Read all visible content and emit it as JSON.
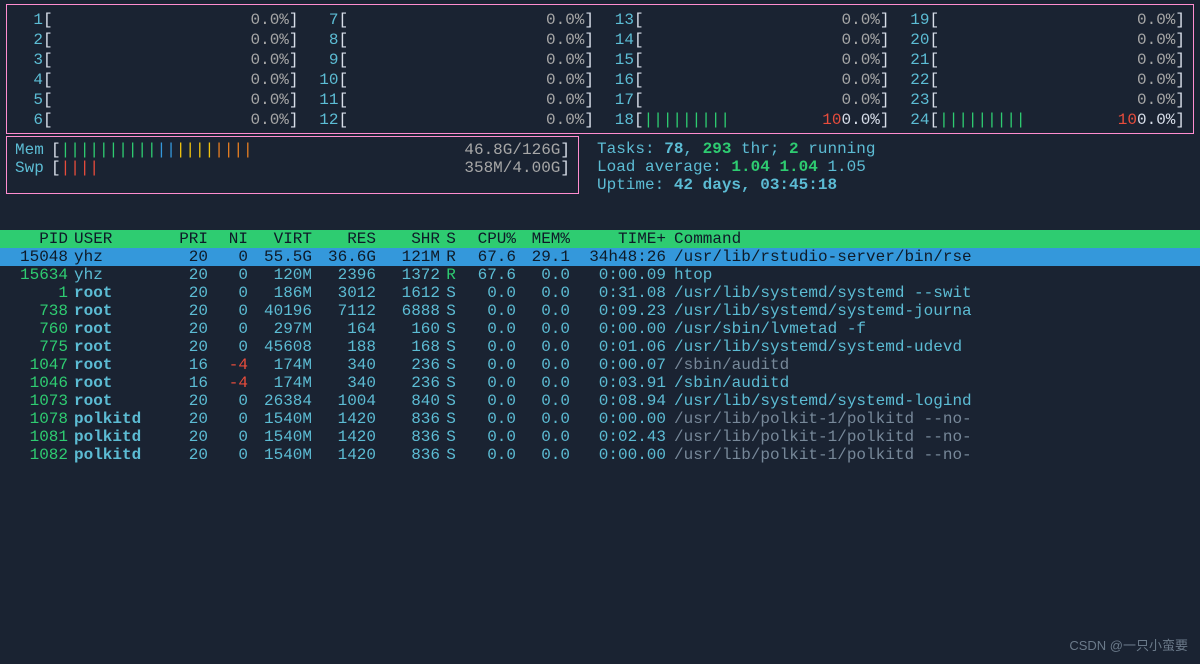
{
  "cpus": [
    {
      "n": "1",
      "fill": "",
      "pct": "0.0%",
      "full": false
    },
    {
      "n": "2",
      "fill": "",
      "pct": "0.0%",
      "full": false
    },
    {
      "n": "3",
      "fill": "",
      "pct": "0.0%",
      "full": false
    },
    {
      "n": "4",
      "fill": "",
      "pct": "0.0%",
      "full": false
    },
    {
      "n": "5",
      "fill": "",
      "pct": "0.0%",
      "full": false
    },
    {
      "n": "6",
      "fill": "",
      "pct": "0.0%",
      "full": false
    },
    {
      "n": "7",
      "fill": "",
      "pct": "0.0%",
      "full": false
    },
    {
      "n": "8",
      "fill": "",
      "pct": "0.0%",
      "full": false
    },
    {
      "n": "9",
      "fill": "",
      "pct": "0.0%",
      "full": false
    },
    {
      "n": "10",
      "fill": "",
      "pct": "0.0%",
      "full": false
    },
    {
      "n": "11",
      "fill": "",
      "pct": "0.0%",
      "full": false
    },
    {
      "n": "12",
      "fill": "",
      "pct": "0.0%",
      "full": false
    },
    {
      "n": "13",
      "fill": "",
      "pct": "0.0%",
      "full": false
    },
    {
      "n": "14",
      "fill": "",
      "pct": "0.0%",
      "full": false
    },
    {
      "n": "15",
      "fill": "",
      "pct": "0.0%",
      "full": false
    },
    {
      "n": "16",
      "fill": "",
      "pct": "0.0%",
      "full": false
    },
    {
      "n": "17",
      "fill": "",
      "pct": "0.0%",
      "full": false
    },
    {
      "n": "18",
      "fill": "|||||||||",
      "pct": "100.0%",
      "full": true
    },
    {
      "n": "19",
      "fill": "",
      "pct": "0.0%",
      "full": false
    },
    {
      "n": "20",
      "fill": "",
      "pct": "0.0%",
      "full": false
    },
    {
      "n": "21",
      "fill": "",
      "pct": "0.0%",
      "full": false
    },
    {
      "n": "22",
      "fill": "",
      "pct": "0.0%",
      "full": false
    },
    {
      "n": "23",
      "fill": "",
      "pct": "0.0%",
      "full": false
    },
    {
      "n": "24",
      "fill": "|||||||||",
      "pct": "100.0%",
      "full": true
    }
  ],
  "mem": {
    "label": "Mem",
    "value": "46.8G/126G"
  },
  "swp": {
    "label": "Swp",
    "value": "358M/4.00G"
  },
  "tasks": {
    "label": "Tasks: ",
    "procs": "78",
    "sep": ", ",
    "threads": "293",
    "thr_lbl": " thr; ",
    "running": "2",
    "run_lbl": " running"
  },
  "load": {
    "label": "Load average: ",
    "l1": "1.04",
    "l5": "1.04",
    "l15": "1.05"
  },
  "uptime": {
    "label": "Uptime: ",
    "value": "42 days, 03:45:18"
  },
  "headers": {
    "pid": "PID",
    "user": "USER",
    "pri": "PRI",
    "ni": "NI",
    "virt": "VIRT",
    "res": "RES",
    "shr": "SHR",
    "s": "S",
    "cpu": "CPU%",
    "mem": "MEM%",
    "time": "TIME+",
    "cmd": "Command"
  },
  "procs": [
    {
      "pid": "15048",
      "user": "yhz",
      "bold": false,
      "pri": "20",
      "ni": "0",
      "ni_red": false,
      "virt": "55.5G",
      "res": "36.6G",
      "shr": "121M",
      "s": "R",
      "s_green": true,
      "cpu": "67.6",
      "mem": "29.1",
      "time": "34h48:26",
      "cmd": "/usr/lib/rstudio-server/bin/rse",
      "gray": false,
      "selected": true
    },
    {
      "pid": "15634",
      "user": "yhz",
      "bold": false,
      "pri": "20",
      "ni": "0",
      "ni_red": false,
      "virt": "120M",
      "res": "2396",
      "shr": "1372",
      "s": "R",
      "s_green": true,
      "cpu": "67.6",
      "mem": "0.0",
      "time": "0:00.09",
      "cmd": "htop",
      "gray": false,
      "selected": false
    },
    {
      "pid": "1",
      "user": "root",
      "bold": true,
      "pri": "20",
      "ni": "0",
      "ni_red": false,
      "virt": "186M",
      "res": "3012",
      "shr": "1612",
      "s": "S",
      "s_green": false,
      "cpu": "0.0",
      "mem": "0.0",
      "time": "0:31.08",
      "cmd": "/usr/lib/systemd/systemd --swit",
      "gray": false,
      "selected": false
    },
    {
      "pid": "738",
      "user": "root",
      "bold": true,
      "pri": "20",
      "ni": "0",
      "ni_red": false,
      "virt": "40196",
      "res": "7112",
      "shr": "6888",
      "s": "S",
      "s_green": false,
      "cpu": "0.0",
      "mem": "0.0",
      "time": "0:09.23",
      "cmd": "/usr/lib/systemd/systemd-journa",
      "gray": false,
      "selected": false
    },
    {
      "pid": "760",
      "user": "root",
      "bold": true,
      "pri": "20",
      "ni": "0",
      "ni_red": false,
      "virt": "297M",
      "res": "164",
      "shr": "160",
      "s": "S",
      "s_green": false,
      "cpu": "0.0",
      "mem": "0.0",
      "time": "0:00.00",
      "cmd": "/usr/sbin/lvmetad -f",
      "gray": false,
      "selected": false
    },
    {
      "pid": "775",
      "user": "root",
      "bold": true,
      "pri": "20",
      "ni": "0",
      "ni_red": false,
      "virt": "45608",
      "res": "188",
      "shr": "168",
      "s": "S",
      "s_green": false,
      "cpu": "0.0",
      "mem": "0.0",
      "time": "0:01.06",
      "cmd": "/usr/lib/systemd/systemd-udevd",
      "gray": false,
      "selected": false
    },
    {
      "pid": "1047",
      "user": "root",
      "bold": true,
      "pri": "16",
      "ni": "-4",
      "ni_red": true,
      "virt": "174M",
      "res": "340",
      "shr": "236",
      "s": "S",
      "s_green": false,
      "cpu": "0.0",
      "mem": "0.0",
      "time": "0:00.07",
      "cmd": "/sbin/auditd",
      "gray": true,
      "selected": false
    },
    {
      "pid": "1046",
      "user": "root",
      "bold": true,
      "pri": "16",
      "ni": "-4",
      "ni_red": true,
      "virt": "174M",
      "res": "340",
      "shr": "236",
      "s": "S",
      "s_green": false,
      "cpu": "0.0",
      "mem": "0.0",
      "time": "0:03.91",
      "cmd": "/sbin/auditd",
      "gray": false,
      "selected": false
    },
    {
      "pid": "1073",
      "user": "root",
      "bold": true,
      "pri": "20",
      "ni": "0",
      "ni_red": false,
      "virt": "26384",
      "res": "1004",
      "shr": "840",
      "s": "S",
      "s_green": false,
      "cpu": "0.0",
      "mem": "0.0",
      "time": "0:08.94",
      "cmd": "/usr/lib/systemd/systemd-logind",
      "gray": false,
      "selected": false
    },
    {
      "pid": "1078",
      "user": "polkitd",
      "bold": true,
      "pri": "20",
      "ni": "0",
      "ni_red": false,
      "virt": "1540M",
      "res": "1420",
      "shr": "836",
      "s": "S",
      "s_green": false,
      "cpu": "0.0",
      "mem": "0.0",
      "time": "0:00.00",
      "cmd": "/usr/lib/polkit-1/polkitd --no-",
      "gray": true,
      "selected": false
    },
    {
      "pid": "1081",
      "user": "polkitd",
      "bold": true,
      "pri": "20",
      "ni": "0",
      "ni_red": false,
      "virt": "1540M",
      "res": "1420",
      "shr": "836",
      "s": "S",
      "s_green": false,
      "cpu": "0.0",
      "mem": "0.0",
      "time": "0:02.43",
      "cmd": "/usr/lib/polkit-1/polkitd --no-",
      "gray": true,
      "selected": false
    },
    {
      "pid": "1082",
      "user": "polkitd",
      "bold": true,
      "pri": "20",
      "ni": "0",
      "ni_red": false,
      "virt": "1540M",
      "res": "1420",
      "shr": "836",
      "s": "S",
      "s_green": false,
      "cpu": "0.0",
      "mem": "0.0",
      "time": "0:00.00",
      "cmd": "/usr/lib/polkit-1/polkitd --no-",
      "gray": true,
      "selected": false
    }
  ],
  "watermark": "CSDN @一只小蛮要"
}
